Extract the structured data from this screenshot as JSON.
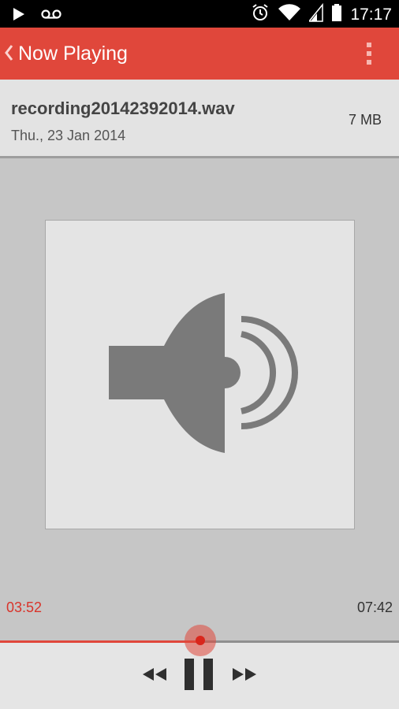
{
  "status_bar": {
    "icons": [
      "play-icon",
      "voicemail-icon",
      "alarm-icon",
      "wifi-icon",
      "signal-icon",
      "battery-icon"
    ],
    "clock": "17:17"
  },
  "action_bar": {
    "title": "Now Playing",
    "back_icon": "chevron-left-icon",
    "menu_icon": "overflow-menu-icon",
    "color": "#e0473b"
  },
  "file": {
    "name": "recording20142392014.wav",
    "date": "Thu., 23 Jan 2014",
    "size": "7 MB"
  },
  "artwork": {
    "icon": "speaker-icon"
  },
  "player": {
    "elapsed": "03:52",
    "total": "07:42",
    "progress_percent": 50.2,
    "accent_color": "#e0473b",
    "controls": [
      "rewind-icon",
      "pause-icon",
      "fast-forward-icon"
    ]
  }
}
